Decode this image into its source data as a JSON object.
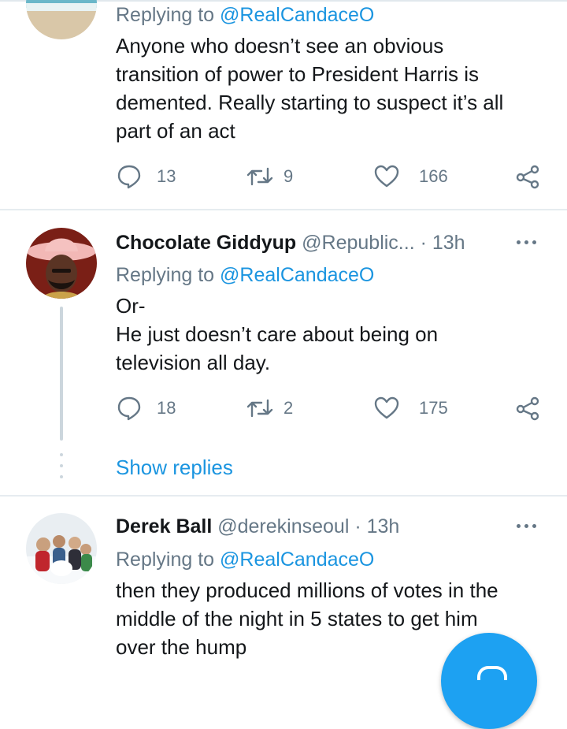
{
  "tweets": [
    {
      "reply_prefix": "Replying to",
      "reply_handle": "@RealCandaceO",
      "text": "Anyone who doesn’t see an obvious\ntransition of power to President Harris is\ndemented. Really starting to suspect it’s all\npart of an act",
      "replies": "13",
      "retweets": "9",
      "likes": "166"
    },
    {
      "name": "Chocolate Giddyup",
      "handle_time": "@Republic... · 13h",
      "reply_prefix": "Replying to",
      "reply_handle": "@RealCandaceO",
      "text": "Or-\nHe just doesn’t care about being on\ntelevision all day.",
      "replies": "18",
      "retweets": "2",
      "likes": "175",
      "show_replies": "Show replies"
    },
    {
      "name": "Derek Ball",
      "handle_time": "@derekinseoul · 13h",
      "reply_prefix": "Replying to",
      "reply_handle": "@RealCandaceO",
      "text": "then they produced millions of votes in the\nmiddle of the night in 5 states to get him\nover the hump"
    }
  ],
  "icons": {
    "reply": "comment-icon",
    "retweet": "retweet-icon",
    "like": "heart-icon",
    "share": "share-icon",
    "more": "more-icon",
    "compose": "compose-icon"
  },
  "colors": {
    "link": "#1b95e0",
    "muted": "#657786",
    "fab": "#1da1f2"
  }
}
